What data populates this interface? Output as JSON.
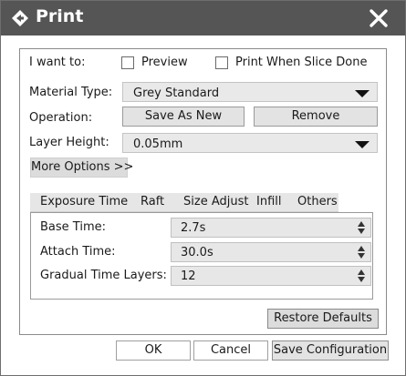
{
  "window": {
    "title": "Print",
    "close_symbol": "✕"
  },
  "main": {
    "i_want_to_label": "I want to:",
    "preview_label": "Preview",
    "print_when_done_label": "Print When Slice Done",
    "material_type_label": "Material Type:",
    "material_type_value": "Grey Standard",
    "operation_label": "Operation:",
    "save_as_new_label": "Save As New",
    "remove_label": "Remove",
    "layer_height_label": "Layer Height:",
    "layer_height_value": "0.05mm",
    "more_options_label": "More Options >>"
  },
  "tabs": [
    "Exposure Time",
    "Raft",
    "Size Adjust",
    "Infill",
    "Others"
  ],
  "exposure": {
    "base_time_label": "Base Time:",
    "base_time_value": "2.7s",
    "attach_time_label": "Attach Time:",
    "attach_time_value": "30.0s",
    "gradual_layers_label": "Gradual Time Layers:",
    "gradual_layers_value": "12"
  },
  "restore_defaults_label": "Restore Defaults",
  "footer": {
    "ok_label": "OK",
    "cancel_label": "Cancel",
    "save_config_label": "Save Configuration"
  },
  "colors": {
    "titlebar": "#555555",
    "button": "#e3e3e3",
    "field": "#e9e9e9"
  }
}
